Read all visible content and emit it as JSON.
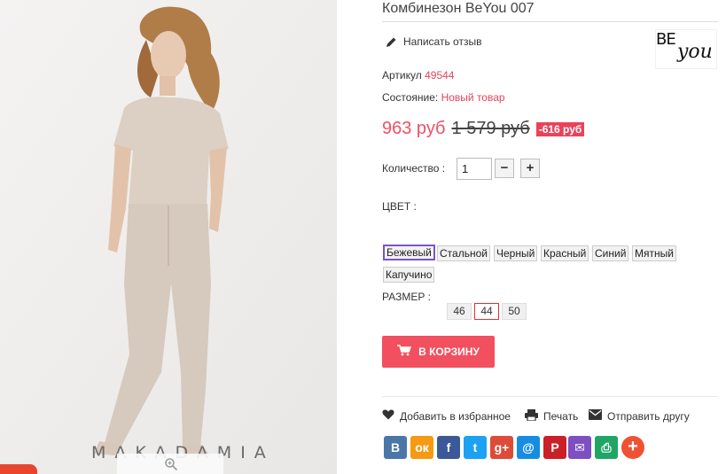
{
  "photo": {
    "brand_text": "MAKADAMIA",
    "zoom_icon": "magnifier-icon"
  },
  "product": {
    "title": "Комбинезон BeYou 007",
    "write_review": "Написать отзыв",
    "logo_be": "BE",
    "logo_you": "you",
    "sku_label": "Артикул",
    "sku_value": "49544",
    "condition_label": "Состояние:",
    "condition_value": "Новый товар",
    "price_new": "963 руб",
    "price_old": "1 579 руб",
    "discount": "-616 руб",
    "qty_label": "Количество :",
    "qty_value": "1",
    "qty_minus": "−",
    "qty_plus": "+",
    "color_label": "ЦВЕТ :",
    "colors": [
      "Бежевый",
      "Стальной",
      "Черный",
      "Красный",
      "Синий",
      "Мятный",
      "Капучино"
    ],
    "selected_color": "Бежевый",
    "size_label": "РАЗМЕР :",
    "sizes": [
      "46",
      "44",
      "50"
    ],
    "selected_size": "44",
    "cart_button": "В КОРЗИНУ"
  },
  "actions": {
    "wishlist": "Добавить в избранное",
    "print": "Печать",
    "send": "Отправить другу"
  },
  "share": [
    {
      "name": "vk",
      "label": "В",
      "color": "#4a76a8"
    },
    {
      "name": "odnoklassniki",
      "label": "ок",
      "color": "#f59a12"
    },
    {
      "name": "facebook",
      "label": "f",
      "color": "#3b5998"
    },
    {
      "name": "twitter",
      "label": "t",
      "color": "#1da1f2"
    },
    {
      "name": "googleplus",
      "label": "g+",
      "color": "#dd4b39"
    },
    {
      "name": "mailru",
      "label": "@",
      "color": "#168de2"
    },
    {
      "name": "pinterest",
      "label": "P",
      "color": "#cb2027"
    },
    {
      "name": "email",
      "label": "✉",
      "color": "#7d4fc0"
    },
    {
      "name": "print",
      "label": "⎙",
      "color": "#21a565"
    },
    {
      "name": "more",
      "label": "+",
      "color": "#ef5233"
    }
  ],
  "colors": {
    "accent": "#e8435a",
    "cart": "#f24f5f",
    "selected_color_border": "#7a55c6",
    "selected_size_border": "#dd3333"
  }
}
